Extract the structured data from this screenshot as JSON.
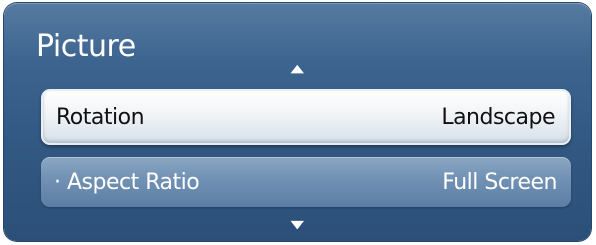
{
  "menu": {
    "title": "Picture",
    "scroll_up_icon": "triangle-up-icon",
    "scroll_down_icon": "triangle-down-icon",
    "items": [
      {
        "label": "Rotation",
        "value": "Landscape",
        "selected": true
      },
      {
        "label": "· Aspect Ratio",
        "value": "Full Screen",
        "selected": false
      }
    ]
  },
  "colors": {
    "panel": "#335a84",
    "selected_row": "#ffffff",
    "normal_row": "#7393b5",
    "text_light": "#ffffff",
    "text_dark": "#111111"
  }
}
